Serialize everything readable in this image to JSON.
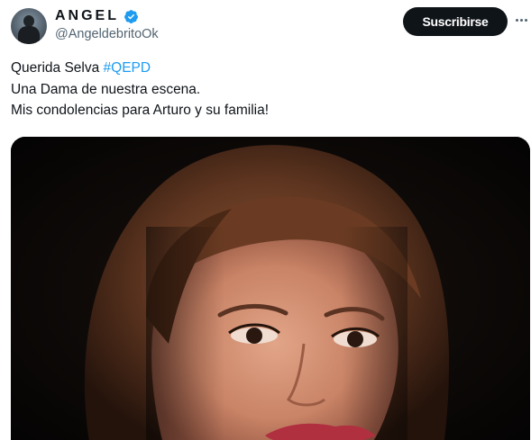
{
  "author": {
    "display_name": "ANGEL",
    "handle": "@AngeldebritoOk",
    "verified_icon": "verified-badge-icon",
    "avatar_icon": "avatar"
  },
  "actions": {
    "subscribe_label": "Suscribirse",
    "more_icon": "more-options-icon"
  },
  "tweet": {
    "line1_text": "Querida Selva ",
    "line1_hashtag": "#QEPD",
    "line2": "Una Dama de nuestra escena.",
    "line3": "Mis condolencias para Arturo y su familia!"
  },
  "colors": {
    "accent": "#1d9bf0",
    "button_bg": "#0f1419",
    "secondary_text": "#536471"
  }
}
